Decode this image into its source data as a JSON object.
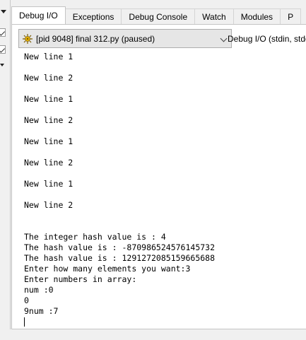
{
  "tabs": [
    {
      "label": "Debug I/O",
      "active": true
    },
    {
      "label": "Exceptions",
      "active": false
    },
    {
      "label": "Debug Console",
      "active": false
    },
    {
      "label": "Watch",
      "active": false
    },
    {
      "label": "Modules",
      "active": false
    },
    {
      "label": "P",
      "active": false
    }
  ],
  "process_select": {
    "value": "[pid 9048] final 312.py (paused)",
    "icon": "debug-bug-icon"
  },
  "io_label": "Debug I/O (stdin, stdo",
  "console_lines": [
    "New line 1",
    "",
    "New line 2",
    "",
    "New line 1",
    "",
    "New line 2",
    "",
    "New line 1",
    "",
    "New line 2",
    "",
    "New line 1",
    "",
    "New line 2",
    "",
    "",
    "The integer hash value is : 4",
    "The hash value is : -870986524576145732",
    "The hash value is : 1291272085159665688",
    "Enter how many elements you want:3",
    "Enter numbers in array:",
    "num :0",
    "0",
    "9num :7"
  ],
  "colors": {
    "panel_bg": "#ffffff",
    "chrome_bg": "#f0f0f0",
    "select_bg": "#e6e6e6"
  }
}
